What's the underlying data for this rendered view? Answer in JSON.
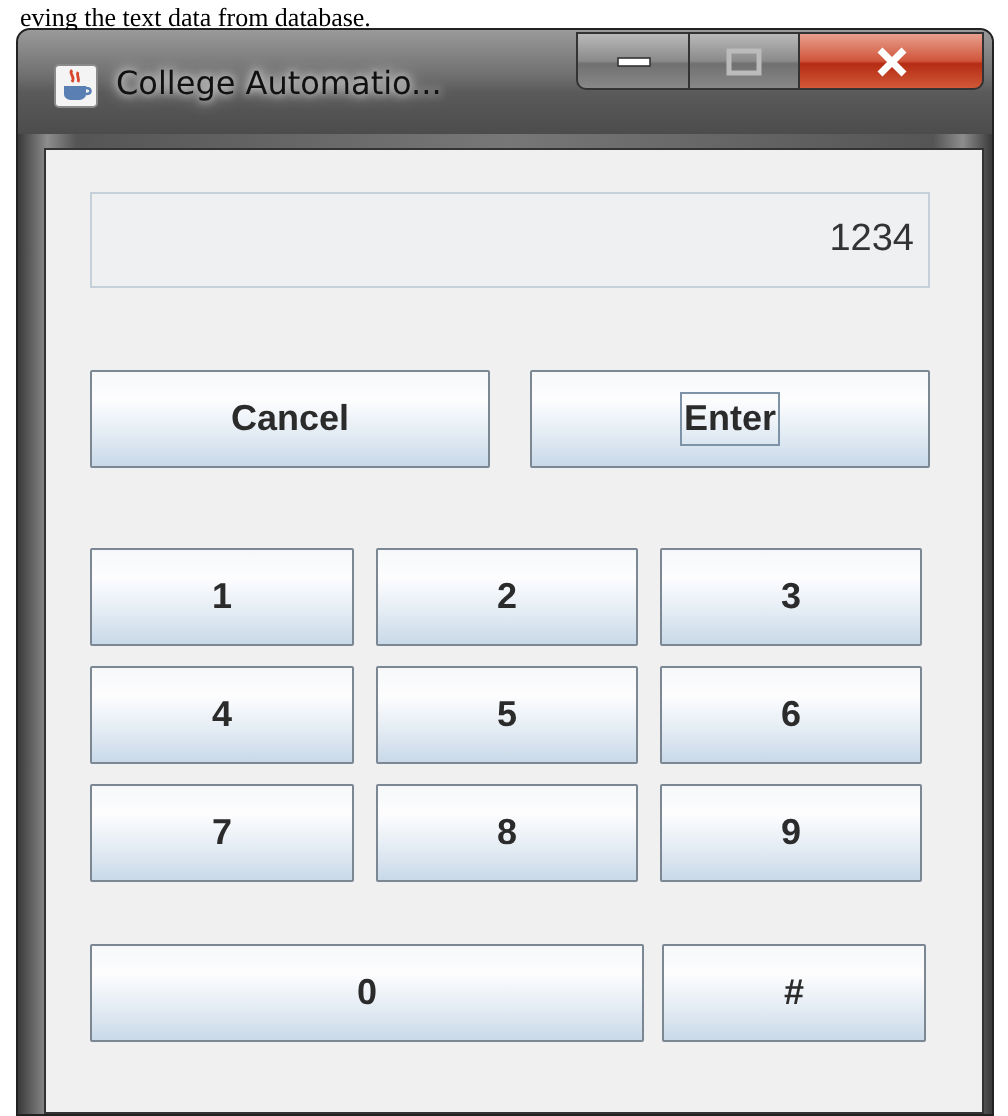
{
  "page_text": "eving the text data from database.",
  "window": {
    "title": "College Automatio...",
    "controls": [
      {
        "kind": "minimize"
      },
      {
        "kind": "maximize"
      },
      {
        "kind": "close"
      }
    ]
  },
  "display": {
    "value": "1234"
  },
  "actions": [
    {
      "label": "Cancel",
      "focused": false
    },
    {
      "label": "Enter",
      "focused": true
    }
  ],
  "keypad": [
    {
      "label": "1"
    },
    {
      "label": "2"
    },
    {
      "label": "3"
    },
    {
      "label": "4"
    },
    {
      "label": "5"
    },
    {
      "label": "6"
    },
    {
      "label": "7"
    },
    {
      "label": "8"
    },
    {
      "label": "9"
    },
    {
      "label": "0",
      "wide": true
    },
    {
      "label": "#",
      "wide": false
    }
  ]
}
